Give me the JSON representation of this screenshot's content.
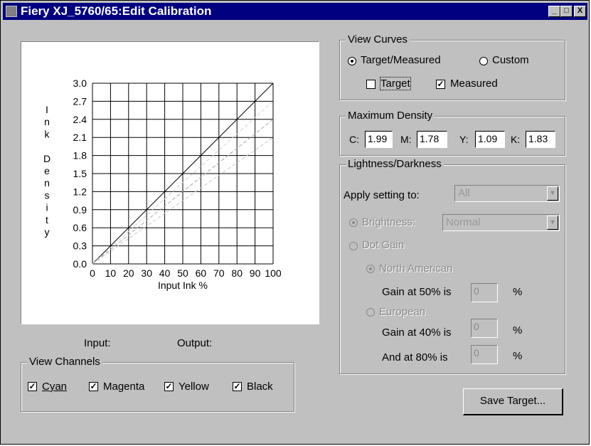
{
  "window": {
    "title": "Fiery XJ_5760/65:Edit Calibration",
    "minimize_glyph": "_",
    "maximize_glyph": "□",
    "close_glyph": "X"
  },
  "chart_data": {
    "type": "line",
    "xlabel": "Input Ink %",
    "ylabel": "Ink Density",
    "x_ticks": [
      "0",
      "10",
      "20",
      "30",
      "40",
      "50",
      "60",
      "70",
      "80",
      "90",
      "100"
    ],
    "y_ticks": [
      "0.0",
      "0.3",
      "0.6",
      "0.9",
      "1.2",
      "1.5",
      "1.8",
      "2.1",
      "2.4",
      "2.7",
      "3.0"
    ],
    "xlim": [
      0,
      100
    ],
    "ylim": [
      0,
      3.0
    ],
    "grid": true,
    "series": [
      {
        "color": "#000000",
        "style": "solid",
        "x": [
          0,
          100
        ],
        "y": [
          0,
          3.0
        ]
      },
      {
        "color": "#a8a8a8",
        "style": "dashed",
        "x": [
          0,
          100
        ],
        "y": [
          0,
          2.4
        ]
      },
      {
        "color": "#d0d0d0",
        "style": "dashed",
        "x": [
          0,
          100
        ],
        "y": [
          0,
          2.7
        ]
      },
      {
        "color": "#c8c8c8",
        "style": "dashed",
        "x": [
          0,
          100
        ],
        "y": [
          0,
          2.1
        ]
      }
    ]
  },
  "readout": {
    "input_label": "Input:",
    "output_label": "Output:"
  },
  "view_channels": {
    "legend": "View Channels",
    "items": [
      {
        "label": "Cyan",
        "checked": true
      },
      {
        "label": "Magenta",
        "checked": true
      },
      {
        "label": "Yellow",
        "checked": true
      },
      {
        "label": "Black",
        "checked": true
      }
    ]
  },
  "view_curves": {
    "legend": "View Curves",
    "target_measured": "Target/Measured",
    "custom": "Custom",
    "target": "Target",
    "measured": "Measured",
    "check_glyph": "✓"
  },
  "max_density": {
    "legend": "Maximum Density",
    "c_label": "C:",
    "c_value": "1.99",
    "m_label": "M:",
    "m_value": "1.78",
    "y_label": "Y:",
    "y_value": "1.09",
    "k_label": "K:",
    "k_value": "1.83"
  },
  "lightness": {
    "legend": "Lightness/Darkness",
    "apply_label": "Apply setting to:",
    "apply_value": "All",
    "brightness_label": "Brightness:",
    "brightness_value": "Normal",
    "dot_gain_label": "Dot Gain",
    "north_american": "North American",
    "gain50_label": "Gain at 50% is",
    "gain50_value": "0",
    "european": "European",
    "gain40_label": "Gain at 40% is",
    "gain40_value": "0",
    "gain80_label": "And at 80% is",
    "gain80_value": "0",
    "percent": "%",
    "dropdown_glyph": "▼"
  },
  "save_target_button": "Save Target..."
}
